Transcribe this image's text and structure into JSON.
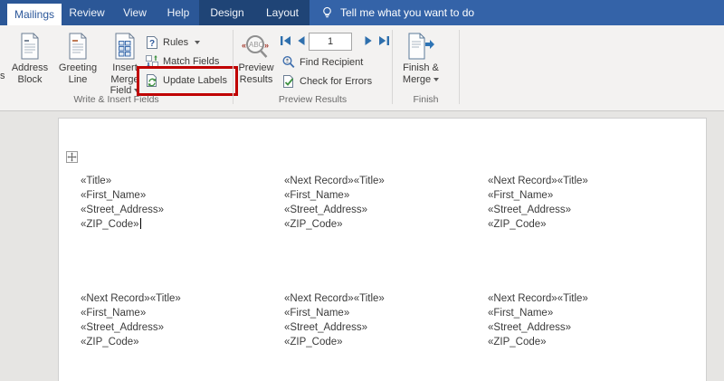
{
  "colors": {
    "tab_blue": "#2b5797",
    "contextual_blue": "#1f4476",
    "tellme_blue": "#3463a8",
    "highlight_red": "#c00000",
    "accent_blue": "#2e6fad"
  },
  "tabbar": {
    "active_tab": "Mailings",
    "tabs": [
      "Review",
      "View",
      "Help"
    ],
    "contextual_tabs": [
      "Design",
      "Layout"
    ],
    "tellme": "Tell me what you want to do"
  },
  "ribbon": {
    "write_insert": {
      "group_label": "Write & Insert Fields",
      "clipped_label": "s",
      "address_block": {
        "line1": "Address",
        "line2": "Block"
      },
      "greeting_line": {
        "line1": "Greeting",
        "line2": "Line"
      },
      "insert_merge_field": {
        "line1": "Insert Merge",
        "line2": "Field"
      },
      "rules": "Rules",
      "match_fields": "Match Fields",
      "update_labels": "Update Labels"
    },
    "preview_results": {
      "group_label": "Preview Results",
      "preview_button": {
        "line1": "Preview",
        "line2": "Results"
      },
      "record_number": "1",
      "find_recipient": "Find Recipient",
      "check_for_errors": "Check for Errors"
    },
    "finish": {
      "group_label": "Finish",
      "finish_merge": {
        "line1": "Finish &",
        "line2": "Merge"
      }
    }
  },
  "document": {
    "cells": [
      {
        "lines": [
          "«Title»",
          "«First_Name»",
          "«Street_Address»",
          "«ZIP_Code»"
        ]
      },
      {
        "lines": [
          "«Next Record»«Title»",
          "«First_Name»",
          "«Street_Address»",
          "«ZIP_Code»"
        ]
      },
      {
        "lines": [
          "«Next Record»«Title»",
          "«First_Name»",
          "«Street_Address»",
          "«ZIP_Code»"
        ]
      },
      {
        "lines": [
          "«Next Record»«Title»",
          "«First_Name»",
          "«Street_Address»",
          "«ZIP_Code»"
        ]
      },
      {
        "lines": [
          "«Next Record»«Title»",
          "«First_Name»",
          "«Street_Address»",
          "«ZIP_Code»"
        ]
      },
      {
        "lines": [
          "«Next Record»«Title»",
          "«First_Name»",
          "«Street_Address»",
          "«ZIP_Code»"
        ]
      }
    ]
  }
}
